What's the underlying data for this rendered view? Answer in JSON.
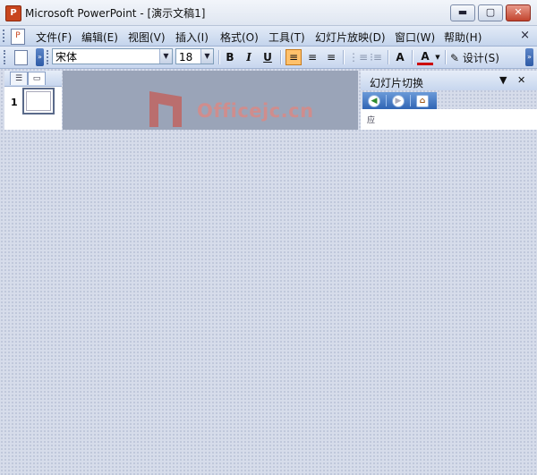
{
  "window": {
    "app_icon_glyph": "P",
    "title": "Microsoft PowerPoint - [演示文稿1]",
    "buttons": {
      "minimize": "▬",
      "maximize": "▢",
      "close": "✕"
    }
  },
  "menubar": {
    "items": [
      "文件(F)",
      "编辑(E)",
      "视图(V)",
      "插入(I)",
      "格式(O)",
      "工具(T)",
      "幻灯片放映(D)",
      "窗口(W)",
      "帮助(H)"
    ],
    "close_glyph": "×"
  },
  "toolbar": {
    "font_name": "宋体",
    "font_size": "18",
    "bold": "B",
    "italic": "I",
    "underline": "U",
    "align_left": "≡",
    "align_center": "≡",
    "align_right": "≡",
    "numbering": "⋮≡",
    "bullets": "⁝≡",
    "grow_font": "A",
    "font_color": "A",
    "design_label": "设计(S)",
    "chevron_glyph": "»",
    "dropdown_glyph": "▼"
  },
  "slides_panel": {
    "tabs": [
      {
        "icon": "outline-tab-icon",
        "glyph": "☰"
      },
      {
        "icon": "slides-tab-icon",
        "glyph": "▭"
      }
    ],
    "slide_numbers": [
      "1"
    ]
  },
  "watermark": {
    "text": "Officejc.cn"
  },
  "task_pane": {
    "title": "幻灯片切换",
    "menu_glyph": "▼",
    "close_glyph": "✕",
    "nav": {
      "back": "◀",
      "forward": "▶",
      "home": "⌂"
    },
    "body_stub": "应"
  },
  "colors": {
    "workspace": "#d6dcea",
    "accent_active": "#ffc16b",
    "nav_blue": "#2f64b4",
    "close_red": "#c2442e",
    "watermark": "#d98a86"
  }
}
